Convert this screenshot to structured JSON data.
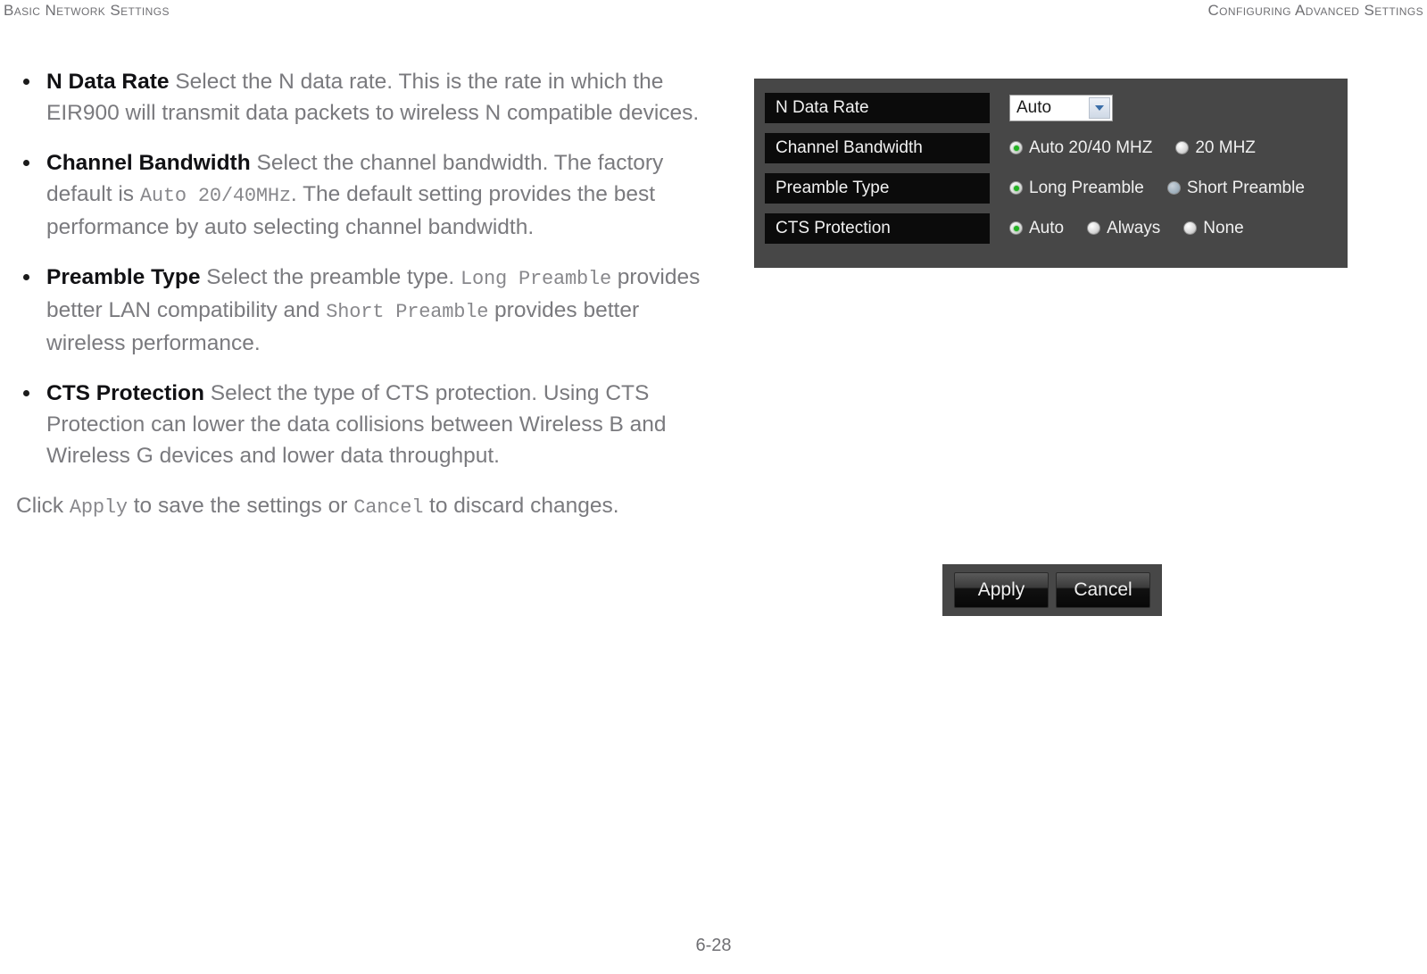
{
  "header": {
    "left": "Basic Network Settings",
    "right": "Configuring Advanced Settings"
  },
  "body": {
    "bullets": [
      {
        "term": "N Data Rate",
        "text": "Select the N data rate. This is the rate in which the EIR900 will transmit data packets to wireless N compatible devices."
      },
      {
        "term": "Channel Bandwidth",
        "text_1": "Select the channel bandwidth. The factory default is ",
        "mono_1": "Auto 20/40MHz",
        "text_2": ". The default setting provides the best performance by auto selecting channel bandwidth."
      },
      {
        "term": "Preamble Type",
        "text_1": "Select the preamble type. ",
        "mono_1": "Long Preamble",
        "text_2": " provides better LAN compatibility and ",
        "mono_2": "Short Preamble",
        "text_3": " provides better wireless performance."
      },
      {
        "term": "CTS Protection",
        "text": "Select the type of CTS protection. Using CTS Protection can lower the data collisions between Wireless B and Wireless G devices and lower data throughput."
      }
    ],
    "closing": {
      "text_1": "Click ",
      "mono_1": "Apply",
      "text_2": " to save the settings or ",
      "mono_2": "Cancel",
      "text_3": " to discard changes."
    }
  },
  "settings_panel": {
    "rows": [
      {
        "label": "N Data Rate",
        "control": "select",
        "value": "Auto"
      },
      {
        "label": "Channel Bandwidth",
        "control": "radio",
        "options": [
          {
            "label": "Auto 20/40 MHZ",
            "selected": true
          },
          {
            "label": "20 MHZ",
            "selected": false
          }
        ]
      },
      {
        "label": "Preamble Type",
        "control": "radio",
        "options": [
          {
            "label": "Long Preamble",
            "selected": true
          },
          {
            "label": "Short Preamble",
            "selected": false
          }
        ]
      },
      {
        "label": "CTS Protection",
        "control": "radio",
        "options": [
          {
            "label": "Auto",
            "selected": true
          },
          {
            "label": "Always",
            "selected": false
          },
          {
            "label": "None",
            "selected": false
          }
        ]
      }
    ]
  },
  "buttons": {
    "apply": "Apply",
    "cancel": "Cancel"
  },
  "footer": {
    "page_number": "6-28"
  },
  "colors": {
    "panel_bg": "#474747",
    "label_bg": "#0b0b0b",
    "radio_selected": "#22b222",
    "body_text": "#7a7a7e",
    "term_text": "#111114",
    "header_text": "#6f6f73"
  }
}
